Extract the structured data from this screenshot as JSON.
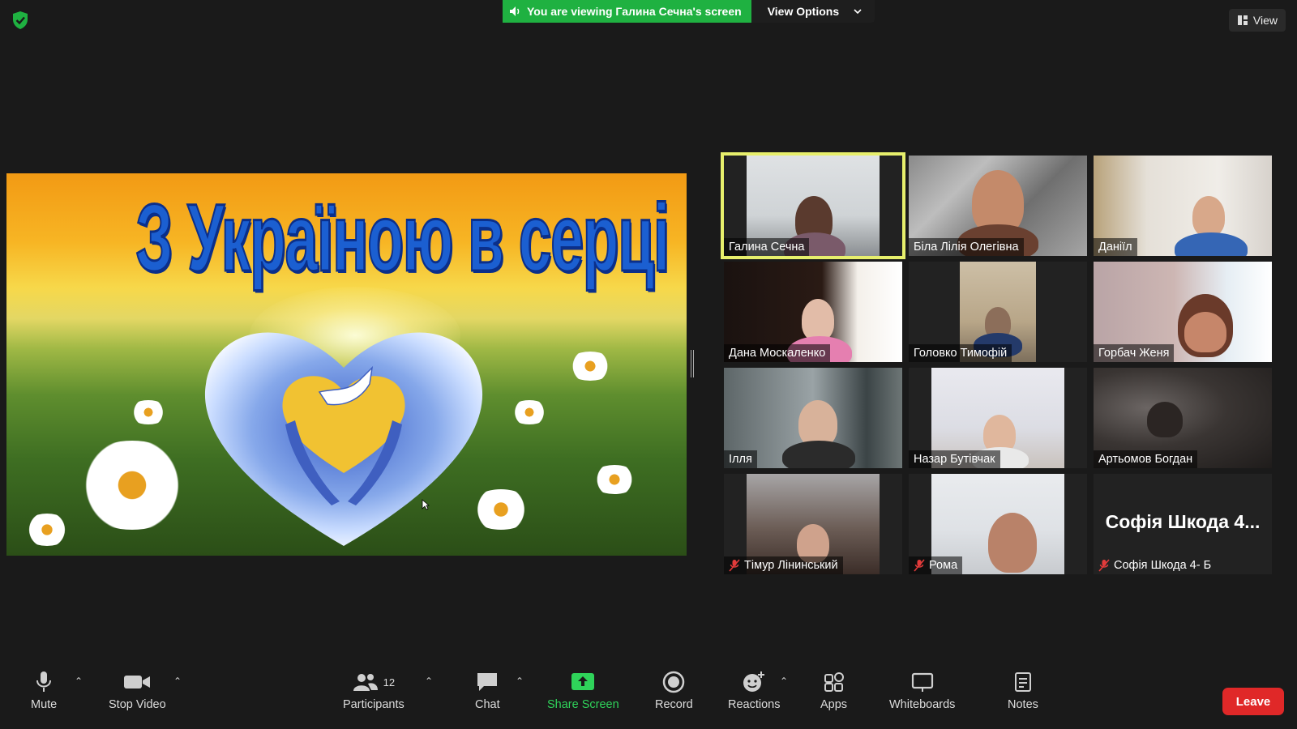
{
  "top": {
    "viewing_text": "You are viewing Галина Сечна's screen",
    "view_options": "View Options",
    "view_button": "View"
  },
  "slide": {
    "title": "З Україною в серці"
  },
  "participants": [
    {
      "name": "Галина Сечна",
      "muted": false,
      "active": true,
      "video": true
    },
    {
      "name": "Біла Лілія Олегівна",
      "muted": false,
      "active": false,
      "video": true
    },
    {
      "name": "Даніїл",
      "muted": false,
      "active": false,
      "video": true
    },
    {
      "name": "Дана Москаленко",
      "muted": false,
      "active": false,
      "video": true
    },
    {
      "name": "Головко Тимофій",
      "muted": false,
      "active": false,
      "video": true
    },
    {
      "name": "Горбач Женя",
      "muted": false,
      "active": false,
      "video": true
    },
    {
      "name": "Ілля",
      "muted": false,
      "active": false,
      "video": true
    },
    {
      "name": "Назар Бутівчак",
      "muted": false,
      "active": false,
      "video": true
    },
    {
      "name": "Артьомов Богдан",
      "muted": false,
      "active": false,
      "video": true
    },
    {
      "name": "Тімур Лінинський",
      "muted": true,
      "active": false,
      "video": true
    },
    {
      "name": "Рома",
      "muted": true,
      "active": false,
      "video": true
    },
    {
      "name": "Софія Шкода 4- Б",
      "display_name": "Софія Шкода 4...",
      "muted": true,
      "active": false,
      "video": false
    }
  ],
  "toolbar": {
    "mute": "Mute",
    "stop_video": "Stop Video",
    "participants": "Participants",
    "participants_count": "12",
    "chat": "Chat",
    "share_screen": "Share Screen",
    "record": "Record",
    "reactions": "Reactions",
    "apps": "Apps",
    "whiteboards": "Whiteboards",
    "notes": "Notes",
    "leave": "Leave"
  },
  "colors": {
    "accent_green": "#1fb141",
    "leave_red": "#e02828",
    "active_speaker": "#e7ef6c"
  }
}
